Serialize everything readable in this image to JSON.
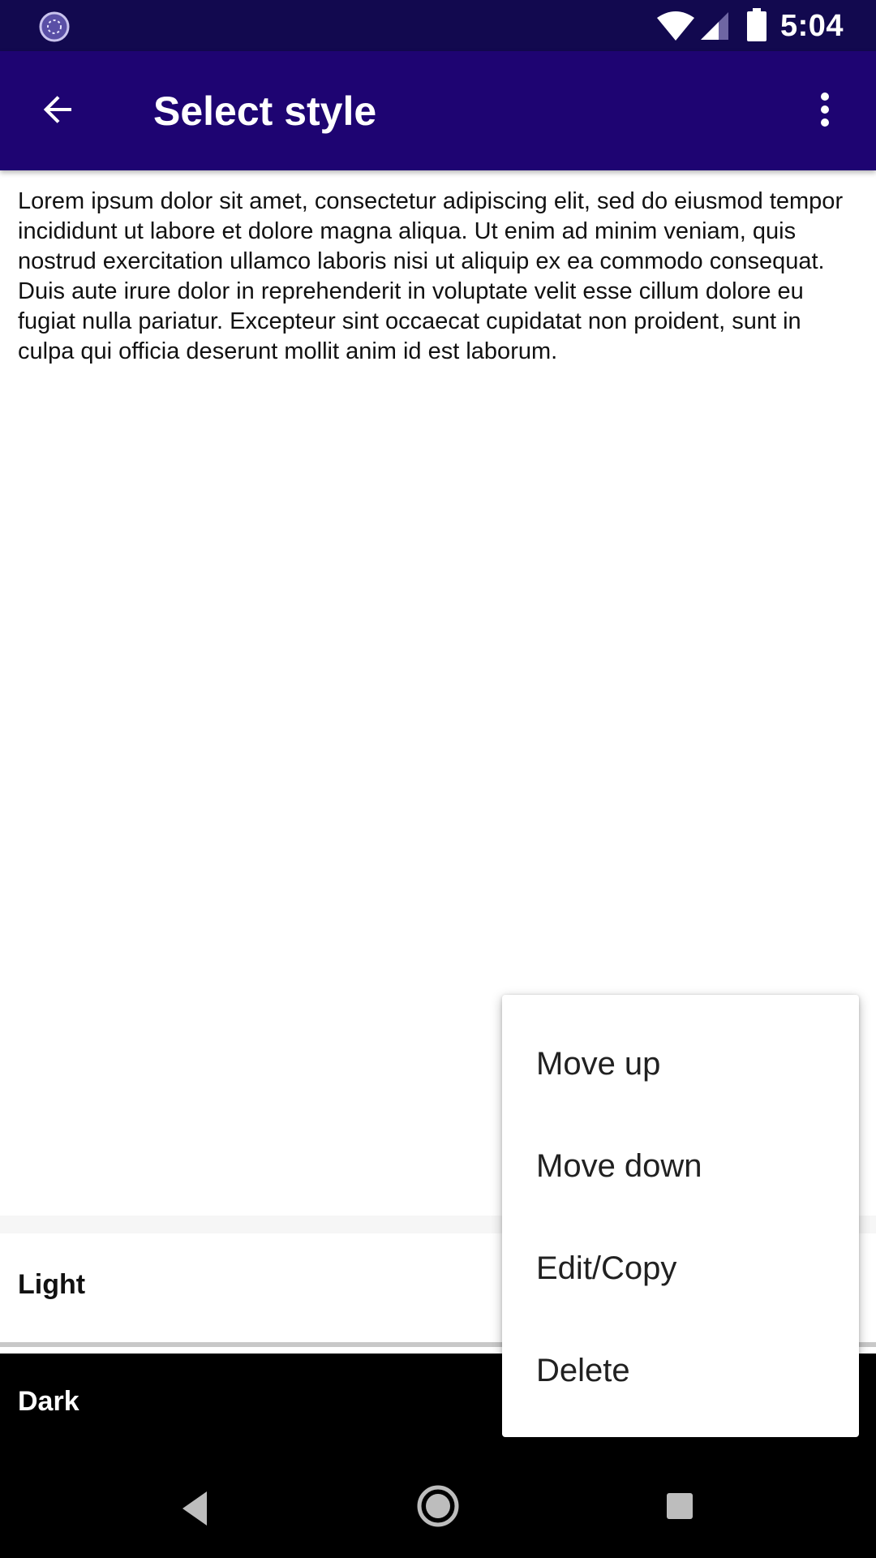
{
  "status_bar": {
    "time": "5:04",
    "icons": [
      "sync-icon",
      "wifi-icon",
      "signal-icon",
      "battery-icon"
    ]
  },
  "app_bar": {
    "title": "Select style",
    "icons": [
      "back-arrow-icon",
      "more-vert-icon"
    ],
    "color": "#1e0472"
  },
  "preview": {
    "text": "Lorem ipsum dolor sit amet, consectetur adipiscing elit, sed do eiusmod tempor incididunt ut labore et dolore magna aliqua. Ut enim ad minim veniam, quis nostrud exercitation ullamco laboris nisi ut aliquip ex ea commodo consequat. Duis aute irure dolor in reprehenderit in voluptate velit esse cillum dolore eu fugiat nulla pariatur. Excepteur sint occaecat cupidatat non proident, sunt in culpa qui officia deserunt mollit anim id est laborum."
  },
  "styles": [
    {
      "label": "Light",
      "background": "#ffffff",
      "text_color": "#111111"
    },
    {
      "label": "Dark",
      "background": "#000000",
      "text_color": "#ffffff"
    }
  ],
  "context_menu": {
    "items": [
      {
        "label": "Move up"
      },
      {
        "label": "Move down"
      },
      {
        "label": "Edit/Copy"
      },
      {
        "label": "Delete"
      }
    ]
  },
  "nav_bar": {
    "icons": [
      "nav-back-icon",
      "nav-home-icon",
      "nav-recents-icon"
    ]
  }
}
